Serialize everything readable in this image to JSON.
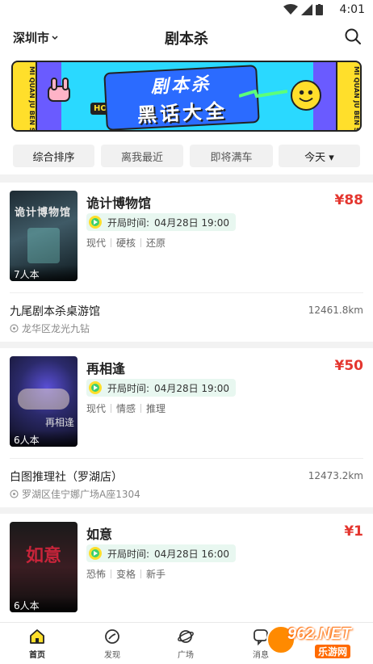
{
  "status": {
    "time": "4:01"
  },
  "header": {
    "city": "深圳市",
    "title": "剧本杀"
  },
  "banner": {
    "line1": "剧本杀",
    "line2": "黑话大全",
    "badge": "HOT",
    "side_text": "MI QUAN JU BEN S"
  },
  "filters": [
    {
      "label": "综合排序"
    },
    {
      "label": "离我最近"
    },
    {
      "label": "即将满车"
    },
    {
      "label": "今天 ▾"
    }
  ],
  "games": [
    {
      "title": "诡计博物馆",
      "price": "¥88",
      "start_label": "开局时间:",
      "start_time": "04月28日 19:00",
      "tags": [
        "现代",
        "硬核",
        "还原"
      ],
      "players": "7人本",
      "poster_text": "诡计博物馆",
      "store": "九尾剧本杀桌游馆",
      "distance": "12461.8km",
      "address": "龙华区龙光九钻"
    },
    {
      "title": "再相逢",
      "price": "¥50",
      "start_label": "开局时间:",
      "start_time": "04月28日 19:00",
      "tags": [
        "现代",
        "情感",
        "推理"
      ],
      "players": "6人本",
      "poster_text": "再相逢",
      "store": "白图推理社（罗湖店）",
      "distance": "12473.2km",
      "address": "罗湖区佳宁娜广场A座1304"
    },
    {
      "title": "如意",
      "price": "¥1",
      "start_label": "开局时间:",
      "start_time": "04月28日 16:00",
      "tags": [
        "恐怖",
        "变格",
        "新手"
      ],
      "players": "6人本",
      "poster_text": "如意"
    }
  ],
  "nav": [
    {
      "label": "首页",
      "icon": "home-icon"
    },
    {
      "label": "发现",
      "icon": "discover-icon"
    },
    {
      "label": "广场",
      "icon": "planet-icon"
    },
    {
      "label": "消息",
      "icon": "message-icon"
    }
  ],
  "watermark": {
    "text": "962.NET",
    "sub": "乐游网"
  },
  "colors": {
    "price": "#e4362f",
    "accent": "#ffdf2b",
    "start_bg": "#e8f7f0"
  }
}
